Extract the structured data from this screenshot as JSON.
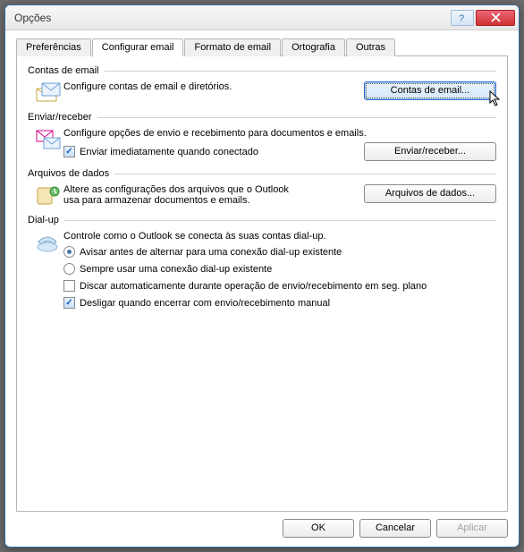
{
  "window": {
    "title": "Opções"
  },
  "tabs": {
    "items": [
      {
        "label": "Preferências"
      },
      {
        "label": "Configurar email"
      },
      {
        "label": "Formato de email"
      },
      {
        "label": "Ortografia"
      },
      {
        "label": "Outras"
      }
    ],
    "active_index": 1
  },
  "groups": {
    "accounts": {
      "label": "Contas de email",
      "desc": "Configure contas de email e diretórios.",
      "button": "Contas de email..."
    },
    "sendrecv": {
      "label": "Enviar/receber",
      "desc": "Configure opções de envio e recebimento para documentos e emails.",
      "check_send_immediate": "Enviar imediatamente quando conectado",
      "button": "Enviar/receber..."
    },
    "datafiles": {
      "label": "Arquivos de dados",
      "desc": "Altere as configurações dos arquivos que o Outlook usa para armazenar documentos e emails.",
      "button": "Arquivos de dados..."
    },
    "dialup": {
      "label": "Dial-up",
      "desc": "Controle como o Outlook se conecta às suas contas dial-up.",
      "radio_warn": "Avisar antes de alternar para uma conexão dial-up existente",
      "radio_always": "Sempre usar uma conexão dial-up existente",
      "check_autodial": "Discar automaticamente durante operação de envio/recebimento em seg. plano",
      "check_hangup": "Desligar quando encerrar com envio/recebimento manual"
    }
  },
  "footer": {
    "ok": "OK",
    "cancel": "Cancelar",
    "apply": "Aplicar"
  },
  "state": {
    "send_immediate": true,
    "dial_radio": "warn",
    "autodial": false,
    "hangup": true
  }
}
